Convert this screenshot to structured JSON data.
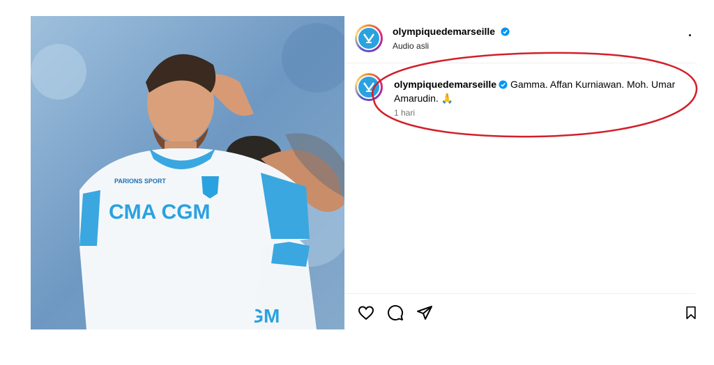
{
  "post": {
    "username": "olympiquedemarseille",
    "audio_label": "Audio asli",
    "caption": "Gamma. Affan Kurniawan. Moh. Umar Amarudin.",
    "caption_emoji": "🙏",
    "time_ago": "1 hari",
    "image": {
      "jersey_sponsor": "CMA CGM",
      "jersey_sponsor_partial": "CGM",
      "sleeve_text": "PARIONS SPORT"
    }
  },
  "icons": {
    "more": "more-options-icon",
    "like": "heart-icon",
    "comment": "comment-icon",
    "share": "send-icon",
    "save": "bookmark-icon",
    "verified": "verified-badge-icon"
  },
  "colors": {
    "verified_blue": "#0095f6",
    "annotation_red": "#d21f2b",
    "club_blue": "#2aa2df"
  }
}
